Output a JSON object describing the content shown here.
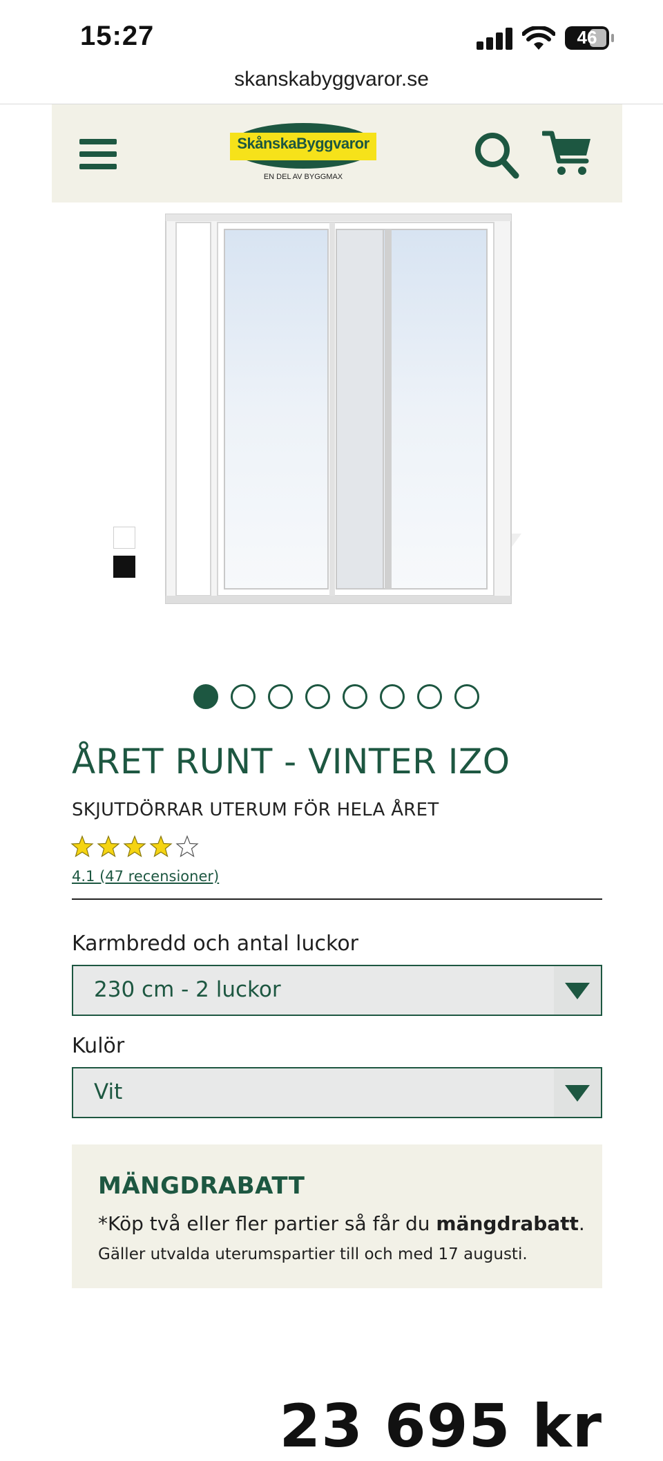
{
  "status_bar": {
    "time": "15:27",
    "battery": "46"
  },
  "browser": {
    "url": "skanskabyggvaror.se"
  },
  "header": {
    "logo_brand": "SkånskaByggvaror",
    "logo_tagline": "EN DEL AV BYGGMAX",
    "menu_icon": "hamburger-icon",
    "search_icon": "search-icon",
    "cart_icon": "cart-icon"
  },
  "gallery": {
    "image_count": 8,
    "active_index": 0
  },
  "colors": {
    "brand_green": "#1d5741",
    "logo_yellow": "#f6e21a",
    "header_bg": "#f2f1e7"
  },
  "product": {
    "title": "ÅRET RUNT - VINTER IZO",
    "subtitle": "SKJUTDÖRRAR UTERUM FÖR HELA ÅRET",
    "rating": 4.1,
    "rating_link": "4.1 (47 recensioner)",
    "price": "23 695 kr"
  },
  "options": {
    "width": {
      "label": "Karmbredd och antal luckor",
      "value": "230 cm - 2 luckor"
    },
    "color": {
      "label": "Kulör",
      "value": "Vit"
    }
  },
  "promo": {
    "heading": "MÄNGDRABATT",
    "line1_prefix": "*Köp två eller fler partier så får du ",
    "line1_bold": "mängdrabatt",
    "line1_suffix": ".",
    "line2": "Gäller utvalda uterumspartier till och med 17 augusti."
  }
}
